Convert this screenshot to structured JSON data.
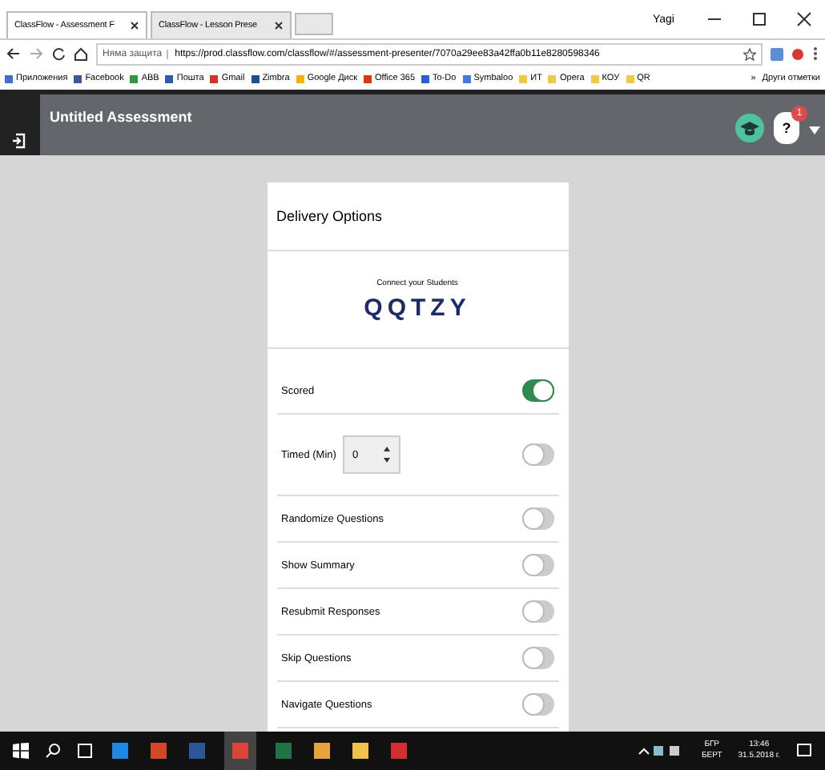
{
  "browser": {
    "tabs": [
      {
        "label": "ClassFlow - Assessment F",
        "selected": true
      },
      {
        "label": "ClassFlow - Lesson Prese",
        "selected": false
      }
    ],
    "user": "Yagi",
    "security": "Няма защита",
    "url": "https://prod.classflow.com/classflow/#/assessment-presenter/7070a29ee83a42ffa0b11e8280598346",
    "bookmarks": [
      {
        "label": "Приложения",
        "color": "#3b6fd6"
      },
      {
        "label": "Facebook",
        "color": "#3b5998"
      },
      {
        "label": "ABB",
        "color": "#2e9a3a"
      },
      {
        "label": "Пошта",
        "color": "#2a5db0"
      },
      {
        "label": "Gmail",
        "color": "#d93025"
      },
      {
        "label": "Zimbra",
        "color": "#1f4e9c"
      },
      {
        "label": "Google Диск",
        "color": "#f4b400"
      },
      {
        "label": "Office 365",
        "color": "#d83b01"
      },
      {
        "label": "To-Do",
        "color": "#2564cf"
      },
      {
        "label": "Symbaloo",
        "color": "#3b7de0"
      },
      {
        "label": "ИТ",
        "color": "#f2c744"
      },
      {
        "label": "Opera",
        "color": "#f2c744"
      },
      {
        "label": "КОУ",
        "color": "#f2c744"
      },
      {
        "label": "QR",
        "color": "#f2c744"
      }
    ],
    "more": "»",
    "other_bookmarks": "Други отметки"
  },
  "app": {
    "title": "Untitled Assessment",
    "notifications": "1",
    "help": "?"
  },
  "card": {
    "title": "Delivery Options",
    "connect_label": "Connect your Students",
    "code": "QQTZY",
    "options": [
      {
        "kind": "toggle",
        "label": "Scored",
        "on": true
      },
      {
        "kind": "timed",
        "label": "Timed (Min)",
        "value": "0",
        "on": false
      },
      {
        "kind": "toggle",
        "label": "Randomize Questions",
        "on": false
      },
      {
        "kind": "toggle",
        "label": "Show Summary",
        "on": false
      },
      {
        "kind": "toggle",
        "label": "Resubmit Responses",
        "on": false
      },
      {
        "kind": "toggle",
        "label": "Skip Questions",
        "on": false
      },
      {
        "kind": "toggle",
        "label": "Navigate Questions",
        "on": false
      }
    ]
  },
  "taskbar": {
    "apps": [
      {
        "kind": "edge",
        "selected": false
      },
      {
        "kind": "powerpoint",
        "selected": false
      },
      {
        "kind": "word",
        "selected": false
      },
      {
        "kind": "chrome",
        "selected": true
      },
      {
        "kind": "excel",
        "selected": false
      },
      {
        "kind": "paint",
        "selected": false
      },
      {
        "kind": "files",
        "selected": false
      },
      {
        "kind": "pdf",
        "selected": false
      }
    ],
    "language": "БГР",
    "layout": "БЕРТ",
    "time": "13:46",
    "date": "31.5.2018 г."
  }
}
